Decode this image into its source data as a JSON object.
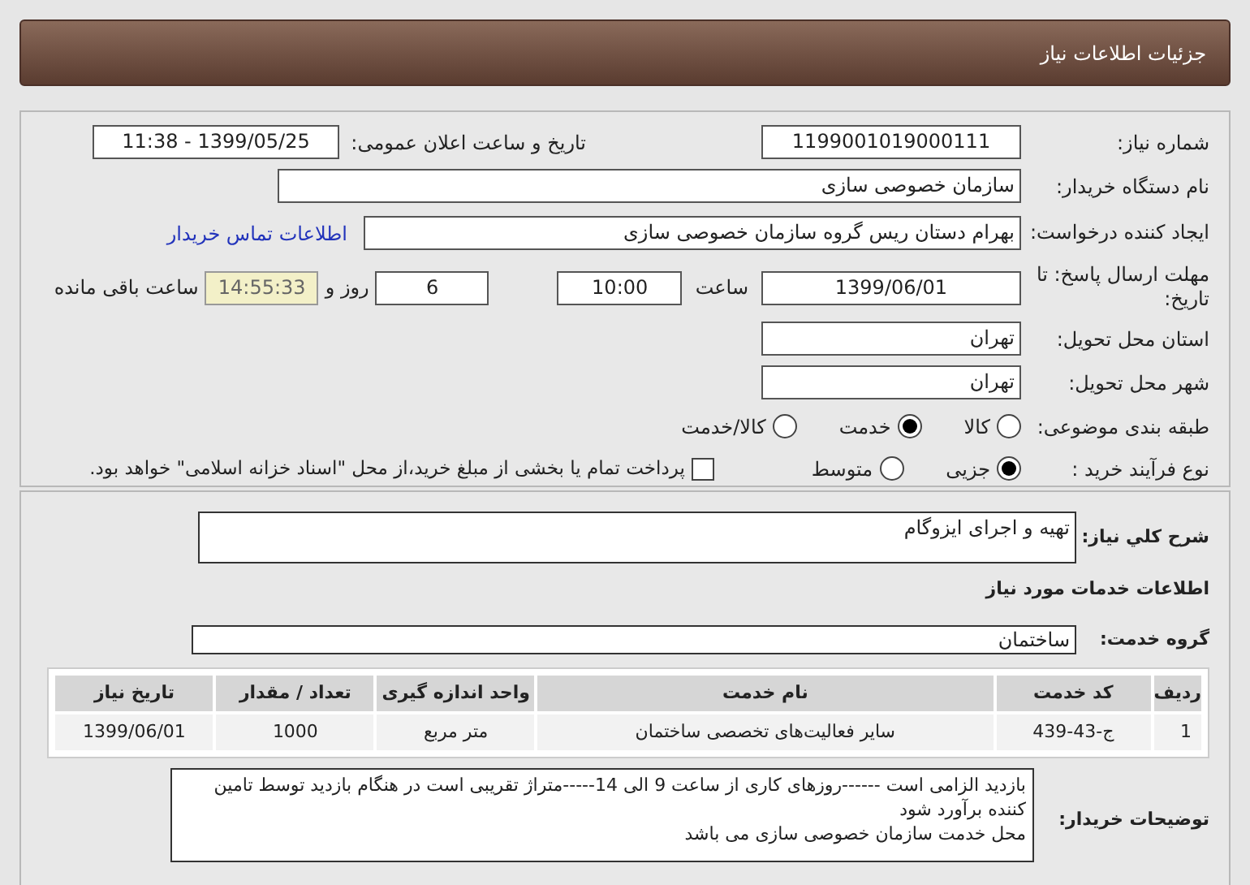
{
  "header": {
    "title": "جزئیات اطلاعات نیاز"
  },
  "need_number": {
    "label": "شماره نیاز:",
    "value": "1199001019000111"
  },
  "announce_date": {
    "label": "تاریخ و ساعت اعلان عمومی:",
    "value": "1399/05/25 - 11:38"
  },
  "buyer_org": {
    "label": "نام دستگاه خریدار:",
    "value": "سازمان خصوصی سازی"
  },
  "requester": {
    "label": "ایجاد کننده درخواست:",
    "value": "بهرام دستان ریس گروه سازمان خصوصی سازی",
    "contact_link": "اطلاعات تماس خریدار"
  },
  "deadline": {
    "label": "مهلت ارسال پاسخ: تا تاریخ:",
    "date": "1399/06/01",
    "time_label": "ساعت",
    "time": "10:00",
    "days": "6",
    "days_label": "روز و",
    "remaining": "14:55:33",
    "remaining_label": "ساعت باقی مانده"
  },
  "province": {
    "label": "استان محل تحویل:",
    "value": "تهران"
  },
  "city": {
    "label": "شهر محل تحویل:",
    "value": "تهران"
  },
  "category": {
    "label": "طبقه بندی موضوعی:",
    "options": [
      {
        "label": "کالا",
        "selected": false
      },
      {
        "label": "خدمت",
        "selected": true
      },
      {
        "label": "کالا/خدمت",
        "selected": false
      }
    ]
  },
  "purchase_process": {
    "label": "نوع فرآیند خرید :",
    "options": [
      {
        "label": "جزیی",
        "selected": true
      },
      {
        "label": "متوسط",
        "selected": false
      }
    ],
    "treasury": {
      "label": "پرداخت تمام یا بخشی از مبلغ خرید،از محل \"اسناد خزانه اسلامی\" خواهد بود.",
      "checked": false
    }
  },
  "description": {
    "label": "شرح کلي نياز:",
    "value": "تهیه و اجرای ایزوگام"
  },
  "services_heading": "اطلاعات خدمات مورد نیاز",
  "service_group": {
    "label": "گروه خدمت:",
    "value": "ساختمان"
  },
  "table": {
    "columns": [
      "ردیف",
      "کد خدمت",
      "نام خدمت",
      "واحد اندازه گیری",
      "تعداد / مقدار",
      "تاریخ نیاز"
    ],
    "rows": [
      [
        "1",
        "ج-43-439",
        "سایر فعالیت‌های تخصصی ساختمان",
        "متر مربع",
        "1000",
        "1399/06/01"
      ]
    ]
  },
  "buyer_notes": {
    "label": "توضیحات خریدار:",
    "lines": [
      "بازدید الزامی است ------روزهای کاری از ساعت 9 الی 14-----متراژ تقریبی است در هنگام بازدید توسط تامین کننده برآورد شود",
      "محل خدمت سازمان خصوصی سازی می باشد"
    ]
  }
}
